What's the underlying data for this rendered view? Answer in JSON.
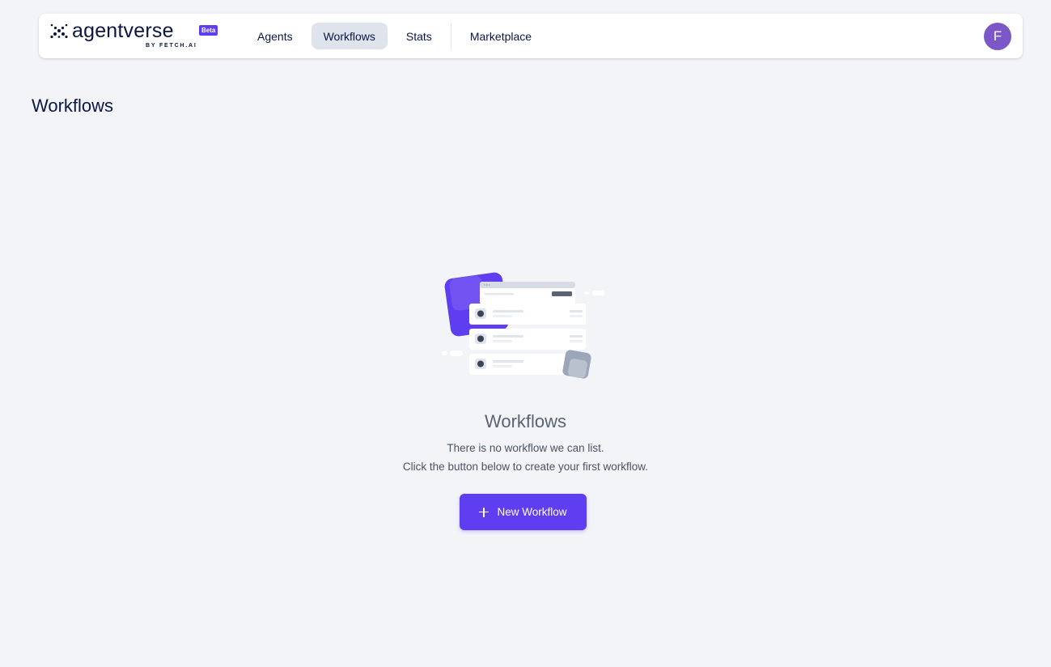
{
  "brand": {
    "name": "agentverse",
    "badge": "Beta",
    "byline": "BY FETCH.AI"
  },
  "nav": {
    "items": [
      {
        "label": "Agents",
        "active": false
      },
      {
        "label": "Workflows",
        "active": true
      },
      {
        "label": "Stats",
        "active": false
      },
      {
        "label": "Marketplace",
        "active": false
      }
    ]
  },
  "user": {
    "avatar_initial": "F"
  },
  "page": {
    "title": "Workflows"
  },
  "empty_state": {
    "title": "Workflows",
    "line1": "There is no workflow we can list.",
    "line2": "Click the button below to create your first workflow.",
    "button_label": "New Workflow",
    "button_icon": "plus-icon"
  },
  "colors": {
    "accent": "#5f3df0",
    "avatar": "#7b57c7",
    "background": "#f2f4f8",
    "nav_active": "#dfe3eb"
  }
}
